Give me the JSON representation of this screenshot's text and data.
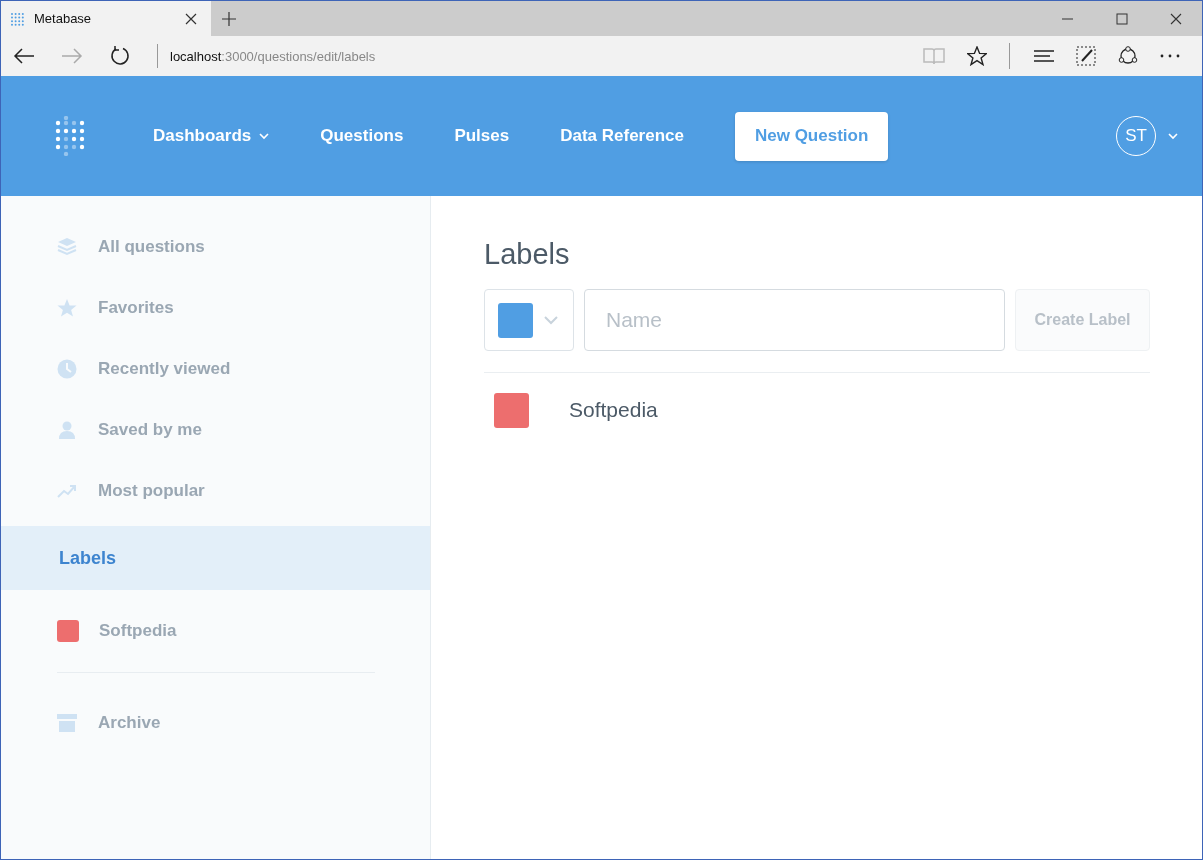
{
  "browser": {
    "tab": {
      "title": "Metabase"
    },
    "address": {
      "host": "localhost",
      "path": ":3000/questions/edit/labels"
    }
  },
  "header": {
    "nav": [
      {
        "label": "Dashboards",
        "dropdown": true
      },
      {
        "label": "Questions",
        "dropdown": false
      },
      {
        "label": "Pulses",
        "dropdown": false
      },
      {
        "label": "Data Reference",
        "dropdown": false
      }
    ],
    "new_question_button": "New Question",
    "user": {
      "initials": "ST"
    }
  },
  "sidebar": {
    "items": [
      {
        "kind": "filter",
        "label": "All questions",
        "selected": false
      },
      {
        "kind": "filter",
        "label": "Favorites",
        "selected": false
      },
      {
        "kind": "filter",
        "label": "Recently viewed",
        "selected": false
      },
      {
        "kind": "filter",
        "label": "Saved by me",
        "selected": false
      },
      {
        "kind": "filter",
        "label": "Most popular",
        "selected": false
      },
      {
        "kind": "heading",
        "label": "Labels",
        "selected": true
      },
      {
        "kind": "label",
        "label": "Softpedia",
        "color": "#ed6e6e",
        "selected": false
      },
      {
        "kind": "archive",
        "label": "Archive",
        "selected": false
      }
    ]
  },
  "main": {
    "title": "Labels",
    "color_picker": {
      "color": "#509ee3"
    },
    "name_field": {
      "placeholder": "Name"
    },
    "create_button": {
      "label": "Create Label",
      "disabled": true
    },
    "labels": [
      {
        "name": "Softpedia",
        "color": "#ed6e6e"
      }
    ]
  }
}
